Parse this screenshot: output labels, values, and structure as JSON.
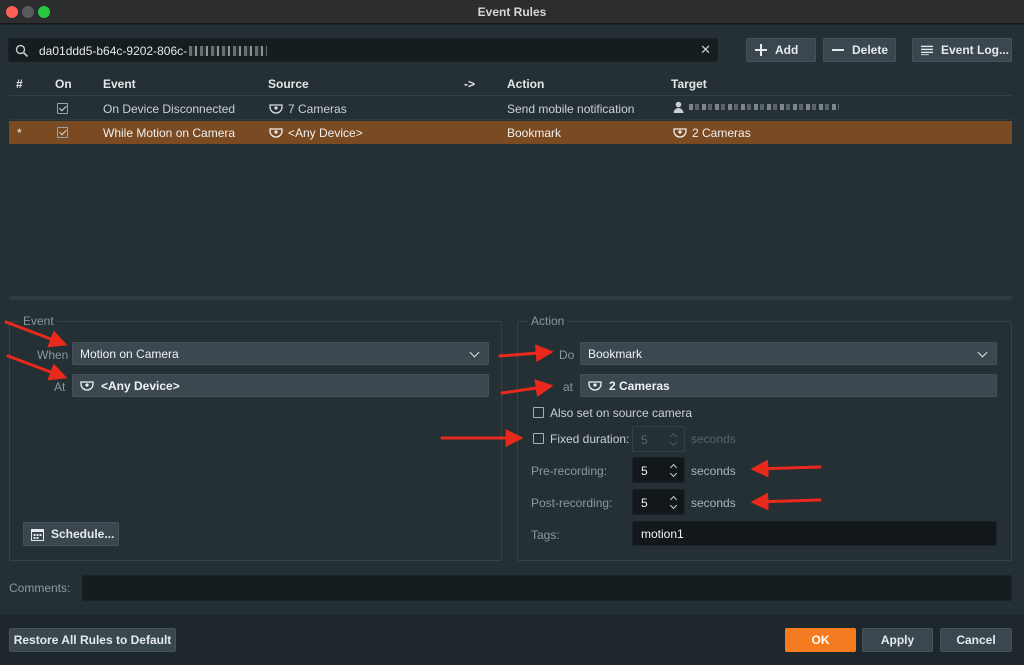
{
  "window": {
    "title": "Event Rules"
  },
  "search": {
    "value": "da01ddd5-b64c-9202-806c-"
  },
  "toolbar": {
    "add_label": "Add",
    "delete_label": "Delete",
    "log_label": "Event Log..."
  },
  "table": {
    "headers": {
      "num": "#",
      "on": "On",
      "event": "Event",
      "source": "Source",
      "arrow": "->",
      "action": "Action",
      "target": "Target"
    },
    "rows": [
      {
        "num": "",
        "on": true,
        "event": "On Device Disconnected",
        "source": "7 Cameras",
        "action": "Send mobile notification",
        "target": ""
      },
      {
        "num": "*",
        "on": true,
        "event": "While Motion on Camera",
        "source": "<Any Device>",
        "action": "Bookmark",
        "target": "2 Cameras"
      }
    ]
  },
  "event_panel": {
    "title": "Event",
    "when_label": "When",
    "when_value": "Motion on Camera",
    "at_label": "At",
    "at_value": "<Any Device>",
    "schedule_label": "Schedule..."
  },
  "action_panel": {
    "title": "Action",
    "do_label": "Do",
    "do_value": "Bookmark",
    "at_label": "at",
    "at_value": "2 Cameras",
    "also_set_label": "Also set on source camera",
    "fixed_duration_label": "Fixed duration:",
    "fixed_duration_value": "5",
    "fixed_duration_unit": "seconds",
    "pre_label": "Pre-recording:",
    "pre_value": "5",
    "pre_unit": "seconds",
    "post_label": "Post-recording:",
    "post_value": "5",
    "post_unit": "seconds",
    "tags_label": "Tags:",
    "tags_value": "motion1"
  },
  "comments": {
    "label": "Comments:"
  },
  "footer": {
    "restore_label": "Restore All Rules to Default",
    "ok_label": "OK",
    "apply_label": "Apply",
    "cancel_label": "Cancel"
  },
  "colors": {
    "accent": "#f47b1f",
    "selected_row": "#7a4a23",
    "annotation_arrow": "#e8291c"
  }
}
